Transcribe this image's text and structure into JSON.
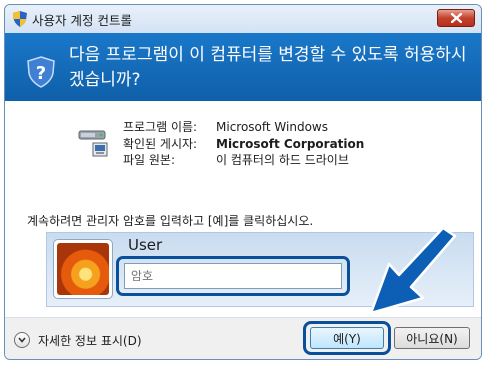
{
  "window": {
    "title": "사용자 계정 컨트롤",
    "close_icon": "close-icon"
  },
  "header": {
    "message": "다음 프로그램이 이 컴퓨터를 변경할 수 있도록 허용하시겠습니까?",
    "icon": "uac-shield-icon",
    "background": "#1468b8"
  },
  "program": {
    "icon": "program-icon",
    "rows": [
      {
        "label": "프로그램 이름:",
        "value": "Microsoft Windows"
      },
      {
        "label": "확인된 게시자:",
        "value": "Microsoft Corporation"
      },
      {
        "label": "파일 원본:",
        "value": "이 컴퓨터의 하드 드라이브"
      }
    ]
  },
  "prompt": "계속하려면 관리자 암호를 입력하고 [예]를 클릭하십시오.",
  "credential": {
    "user_name": "User",
    "password_placeholder": "암호",
    "password_value": ""
  },
  "footer": {
    "details_label": "자세한 정보 표시(D)",
    "yes_label": "예(Y)",
    "no_label": "아니요(N)"
  },
  "annotation": {
    "arrow_icon": "pointer-arrow-icon",
    "highlight_color": "#0a4f9a"
  }
}
